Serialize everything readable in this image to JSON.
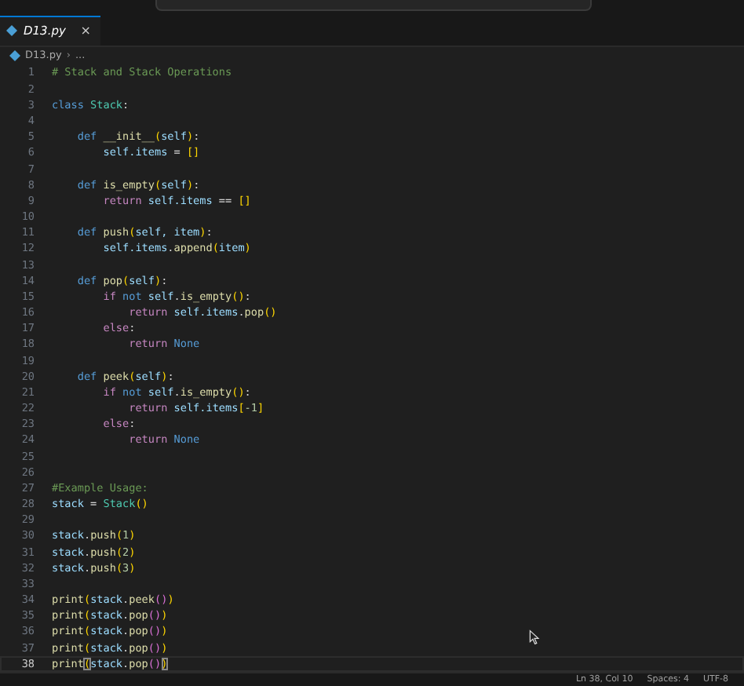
{
  "tab": {
    "label": "D13.py",
    "selected": true,
    "close": "×"
  },
  "breadcrumb": {
    "file": "D13.py",
    "separator": "›",
    "rest": "..."
  },
  "lines": [
    {
      "number": "1",
      "tokens": [
        {
          "kind": "comment",
          "text": "# Stack and Stack Operations"
        }
      ]
    },
    {
      "number": "2"
    },
    {
      "number": "3",
      "tokens": [
        {
          "kind": "keyword",
          "text": "class"
        },
        {
          "kind": "class",
          "text": " Stack"
        },
        {
          "kind": "op",
          "text": ":"
        }
      ]
    },
    {
      "number": "4"
    },
    {
      "number": "5",
      "tokens": [
        {
          "kind": "keyword",
          "text": "    def"
        },
        {
          "kind": "func",
          "text": " __init__"
        },
        {
          "kind": "bracket1",
          "text": "("
        },
        {
          "kind": "var",
          "text": "self"
        },
        {
          "kind": "bracket1",
          "text": ")"
        },
        {
          "kind": "op",
          "text": ":"
        }
      ]
    },
    {
      "number": "6",
      "tokens": [
        {
          "kind": "var",
          "text": "        self.items"
        },
        {
          "kind": "op",
          "text": " = "
        },
        {
          "kind": "bracket1",
          "text": "[]"
        }
      ]
    },
    {
      "number": "7"
    },
    {
      "number": "8",
      "tokens": [
        {
          "kind": "keyword",
          "text": "    def"
        },
        {
          "kind": "func",
          "text": " is_empty"
        },
        {
          "kind": "bracket1",
          "text": "("
        },
        {
          "kind": "var",
          "text": "self"
        },
        {
          "kind": "bracket1",
          "text": ")"
        },
        {
          "kind": "op",
          "text": ":"
        }
      ]
    },
    {
      "number": "9",
      "tokens": [
        {
          "kind": "control",
          "text": "        return"
        },
        {
          "kind": "var",
          "text": " self.items"
        },
        {
          "kind": "op",
          "text": " == "
        },
        {
          "kind": "bracket1",
          "text": "[]"
        }
      ]
    },
    {
      "number": "10"
    },
    {
      "number": "11",
      "tokens": [
        {
          "kind": "keyword",
          "text": "    def"
        },
        {
          "kind": "func",
          "text": " push"
        },
        {
          "kind": "bracket1",
          "text": "("
        },
        {
          "kind": "var",
          "text": "self, item"
        },
        {
          "kind": "bracket1",
          "text": ")"
        },
        {
          "kind": "op",
          "text": ":"
        }
      ]
    },
    {
      "number": "12",
      "tokens": [
        {
          "kind": "var",
          "text": "        self.items"
        },
        {
          "kind": "op",
          "text": "."
        },
        {
          "kind": "func",
          "text": "append"
        },
        {
          "kind": "bracket1",
          "text": "("
        },
        {
          "kind": "var",
          "text": "item"
        },
        {
          "kind": "bracket1",
          "text": ")"
        }
      ]
    },
    {
      "number": "13"
    },
    {
      "number": "14",
      "tokens": [
        {
          "kind": "keyword",
          "text": "    def"
        },
        {
          "kind": "func",
          "text": " pop"
        },
        {
          "kind": "bracket1",
          "text": "("
        },
        {
          "kind": "var",
          "text": "self"
        },
        {
          "kind": "bracket1",
          "text": ")"
        },
        {
          "kind": "op",
          "text": ":"
        }
      ]
    },
    {
      "number": "15",
      "tokens": [
        {
          "kind": "control",
          "text": "        if"
        },
        {
          "kind": "keyword",
          "text": " not"
        },
        {
          "kind": "var",
          "text": " self"
        },
        {
          "kind": "op",
          "text": "."
        },
        {
          "kind": "func",
          "text": "is_empty"
        },
        {
          "kind": "bracket1",
          "text": "()"
        },
        {
          "kind": "op",
          "text": ":"
        }
      ]
    },
    {
      "number": "16",
      "tokens": [
        {
          "kind": "control",
          "text": "            return"
        },
        {
          "kind": "var",
          "text": " self.items"
        },
        {
          "kind": "op",
          "text": "."
        },
        {
          "kind": "func",
          "text": "pop"
        },
        {
          "kind": "bracket1",
          "text": "()"
        }
      ]
    },
    {
      "number": "17",
      "tokens": [
        {
          "kind": "control",
          "text": "        else"
        },
        {
          "kind": "op",
          "text": ":"
        }
      ]
    },
    {
      "number": "18",
      "tokens": [
        {
          "kind": "control",
          "text": "            return"
        },
        {
          "kind": "keyword",
          "text": " None"
        }
      ]
    },
    {
      "number": "19"
    },
    {
      "number": "20",
      "tokens": [
        {
          "kind": "keyword",
          "text": "    def"
        },
        {
          "kind": "func",
          "text": " peek"
        },
        {
          "kind": "bracket1",
          "text": "("
        },
        {
          "kind": "var",
          "text": "self"
        },
        {
          "kind": "bracket1",
          "text": ")"
        },
        {
          "kind": "op",
          "text": ":"
        }
      ]
    },
    {
      "number": "21",
      "tokens": [
        {
          "kind": "control",
          "text": "        if"
        },
        {
          "kind": "keyword",
          "text": " not"
        },
        {
          "kind": "var",
          "text": " self"
        },
        {
          "kind": "op",
          "text": "."
        },
        {
          "kind": "func",
          "text": "is_empty"
        },
        {
          "kind": "bracket1",
          "text": "()"
        },
        {
          "kind": "op",
          "text": ":"
        }
      ]
    },
    {
      "number": "22",
      "tokens": [
        {
          "kind": "control",
          "text": "            return"
        },
        {
          "kind": "var",
          "text": " self.items"
        },
        {
          "kind": "bracket1",
          "text": "["
        },
        {
          "kind": "number",
          "text": "-1"
        },
        {
          "kind": "bracket1",
          "text": "]"
        }
      ]
    },
    {
      "number": "23",
      "tokens": [
        {
          "kind": "control",
          "text": "        else"
        },
        {
          "kind": "op",
          "text": ":"
        }
      ]
    },
    {
      "number": "24",
      "tokens": [
        {
          "kind": "control",
          "text": "            return"
        },
        {
          "kind": "keyword",
          "text": " None"
        }
      ]
    },
    {
      "number": "25"
    },
    {
      "number": "26"
    },
    {
      "number": "27",
      "tokens": [
        {
          "kind": "comment",
          "text": "#Example Usage:"
        }
      ]
    },
    {
      "number": "28",
      "tokens": [
        {
          "kind": "var",
          "text": "stack"
        },
        {
          "kind": "op",
          "text": " = "
        },
        {
          "kind": "class",
          "text": "Stack"
        },
        {
          "kind": "bracket1",
          "text": "()"
        }
      ]
    },
    {
      "number": "29"
    },
    {
      "number": "30",
      "tokens": [
        {
          "kind": "var",
          "text": "stack"
        },
        {
          "kind": "op",
          "text": "."
        },
        {
          "kind": "func",
          "text": "push"
        },
        {
          "kind": "bracket1",
          "text": "("
        },
        {
          "kind": "number",
          "text": "1"
        },
        {
          "kind": "bracket1",
          "text": ")"
        }
      ]
    },
    {
      "number": "31",
      "tokens": [
        {
          "kind": "var",
          "text": "stack"
        },
        {
          "kind": "op",
          "text": "."
        },
        {
          "kind": "func",
          "text": "push"
        },
        {
          "kind": "bracket1",
          "text": "("
        },
        {
          "kind": "number",
          "text": "2"
        },
        {
          "kind": "bracket1",
          "text": ")"
        }
      ]
    },
    {
      "number": "32",
      "tokens": [
        {
          "kind": "var",
          "text": "stack"
        },
        {
          "kind": "op",
          "text": "."
        },
        {
          "kind": "func",
          "text": "push"
        },
        {
          "kind": "bracket1",
          "text": "("
        },
        {
          "kind": "number",
          "text": "3"
        },
        {
          "kind": "bracket1",
          "text": ")"
        }
      ]
    },
    {
      "number": "33"
    },
    {
      "number": "34",
      "tokens": [
        {
          "kind": "func",
          "text": "print"
        },
        {
          "kind": "bracket1",
          "text": "("
        },
        {
          "kind": "var",
          "text": "stack"
        },
        {
          "kind": "op",
          "text": "."
        },
        {
          "kind": "func",
          "text": "peek"
        },
        {
          "kind": "bracket2",
          "text": "()"
        },
        {
          "kind": "bracket1",
          "text": ")"
        }
      ]
    },
    {
      "number": "35",
      "tokens": [
        {
          "kind": "func",
          "text": "print"
        },
        {
          "kind": "bracket1",
          "text": "("
        },
        {
          "kind": "var",
          "text": "stack"
        },
        {
          "kind": "op",
          "text": "."
        },
        {
          "kind": "func",
          "text": "pop"
        },
        {
          "kind": "bracket2",
          "text": "()"
        },
        {
          "kind": "bracket1",
          "text": ")"
        }
      ]
    },
    {
      "number": "36",
      "tokens": [
        {
          "kind": "func",
          "text": "print"
        },
        {
          "kind": "bracket1",
          "text": "("
        },
        {
          "kind": "var",
          "text": "stack"
        },
        {
          "kind": "op",
          "text": "."
        },
        {
          "kind": "func",
          "text": "pop"
        },
        {
          "kind": "bracket2",
          "text": "()"
        },
        {
          "kind": "bracket1",
          "text": ")"
        }
      ]
    },
    {
      "number": "37",
      "tokens": [
        {
          "kind": "func",
          "text": "print"
        },
        {
          "kind": "bracket1",
          "text": "("
        },
        {
          "kind": "var",
          "text": "stack"
        },
        {
          "kind": "op",
          "text": "."
        },
        {
          "kind": "func",
          "text": "pop"
        },
        {
          "kind": "bracket2",
          "text": "()"
        },
        {
          "kind": "bracket1",
          "text": ")"
        }
      ]
    },
    {
      "number": "38",
      "current": true,
      "tokens": [
        {
          "kind": "func",
          "text": "print"
        },
        {
          "kind": "match",
          "text": "("
        },
        {
          "kind": "var",
          "text": "stack"
        },
        {
          "kind": "op",
          "text": "."
        },
        {
          "kind": "func",
          "text": "pop"
        },
        {
          "kind": "bracket2",
          "text": "()"
        },
        {
          "kind": "match",
          "text": ")"
        }
      ]
    }
  ],
  "status_bar": [
    "Ln 38, Col 10",
    "Spaces: 4",
    "UTF-8"
  ]
}
